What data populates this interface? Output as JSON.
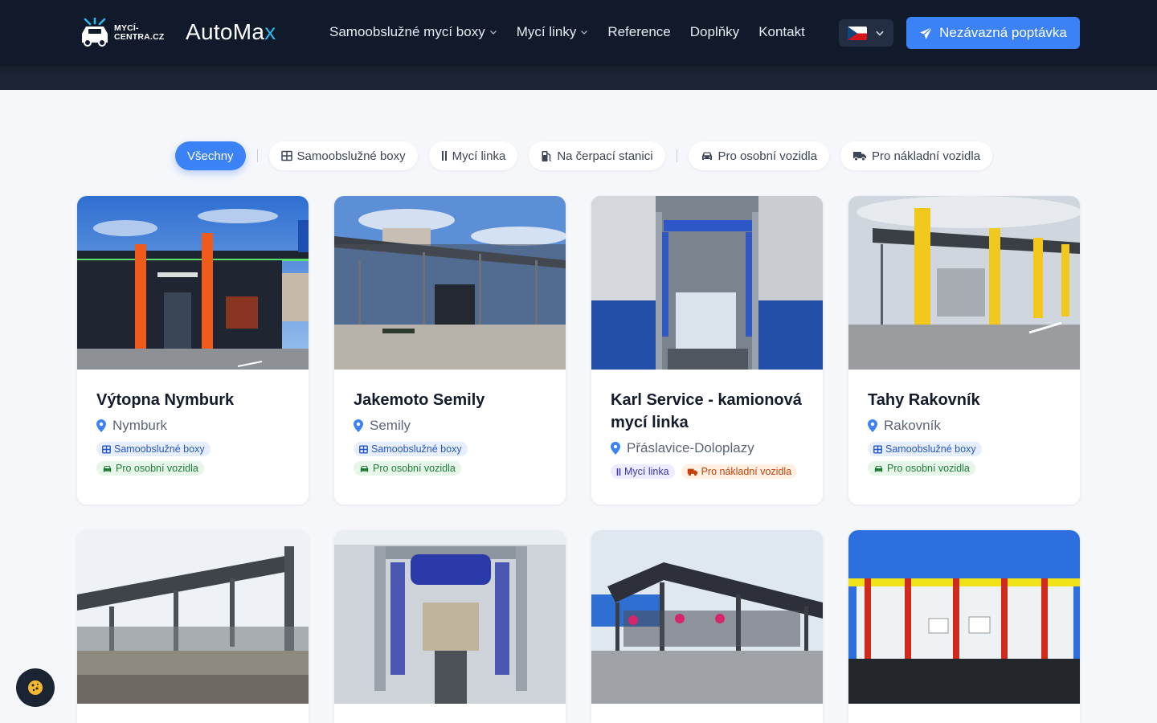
{
  "header": {
    "logo1_line1": "MYCÍ-",
    "logo1_line2": "CENTRA.CZ",
    "logo2_main": "AutoMa",
    "logo2_accent": "x",
    "nav": [
      {
        "label": "Samoobslužné mycí boxy",
        "dropdown": true
      },
      {
        "label": "Mycí linky",
        "dropdown": true
      },
      {
        "label": "Reference",
        "dropdown": false
      },
      {
        "label": "Doplňky",
        "dropdown": false
      },
      {
        "label": "Kontakt",
        "dropdown": false
      }
    ],
    "language": "CZ",
    "cta_label": "Nezávazná poptávka"
  },
  "filters": [
    {
      "label": "Všechny",
      "icon": "none",
      "active": true
    },
    {
      "label": "Samoobslužné boxy",
      "icon": "grid-icon",
      "active": false
    },
    {
      "label": "Mycí linka",
      "icon": "bars-icon",
      "active": false
    },
    {
      "label": "Na čerpací stanici",
      "icon": "fuel-icon",
      "active": false
    },
    {
      "label": "Pro osobní vozidla",
      "icon": "car-icon",
      "active": false
    },
    {
      "label": "Pro nákladní vozidla",
      "icon": "truck-icon",
      "active": false
    }
  ],
  "cards": [
    {
      "title": "Výtopna Nymburk",
      "location": "Nymburk",
      "tags": [
        {
          "label": "Samoobslužné boxy",
          "style": "blue"
        },
        {
          "label": "Pro osobní vozidla",
          "style": "green"
        }
      ]
    },
    {
      "title": "Jakemoto Semily",
      "location": "Semily",
      "tags": [
        {
          "label": "Samoobslužné boxy",
          "style": "blue"
        },
        {
          "label": "Pro osobní vozidla",
          "style": "green"
        }
      ]
    },
    {
      "title": "Karl Service - kamionová mycí linka",
      "location": "Přáslavice-Doloplazy",
      "tags": [
        {
          "label": "Mycí linka",
          "style": "indigo"
        },
        {
          "label": "Pro nákladní vozidla",
          "style": "orange"
        }
      ]
    },
    {
      "title": "Tahy Rakovník",
      "location": "Rakovník",
      "tags": [
        {
          "label": "Samoobslužné boxy",
          "style": "blue"
        },
        {
          "label": "Pro osobní vozidla",
          "style": "green"
        }
      ]
    }
  ],
  "colors": {
    "accent": "#3b82f6",
    "header_bg": "#111a2b"
  }
}
